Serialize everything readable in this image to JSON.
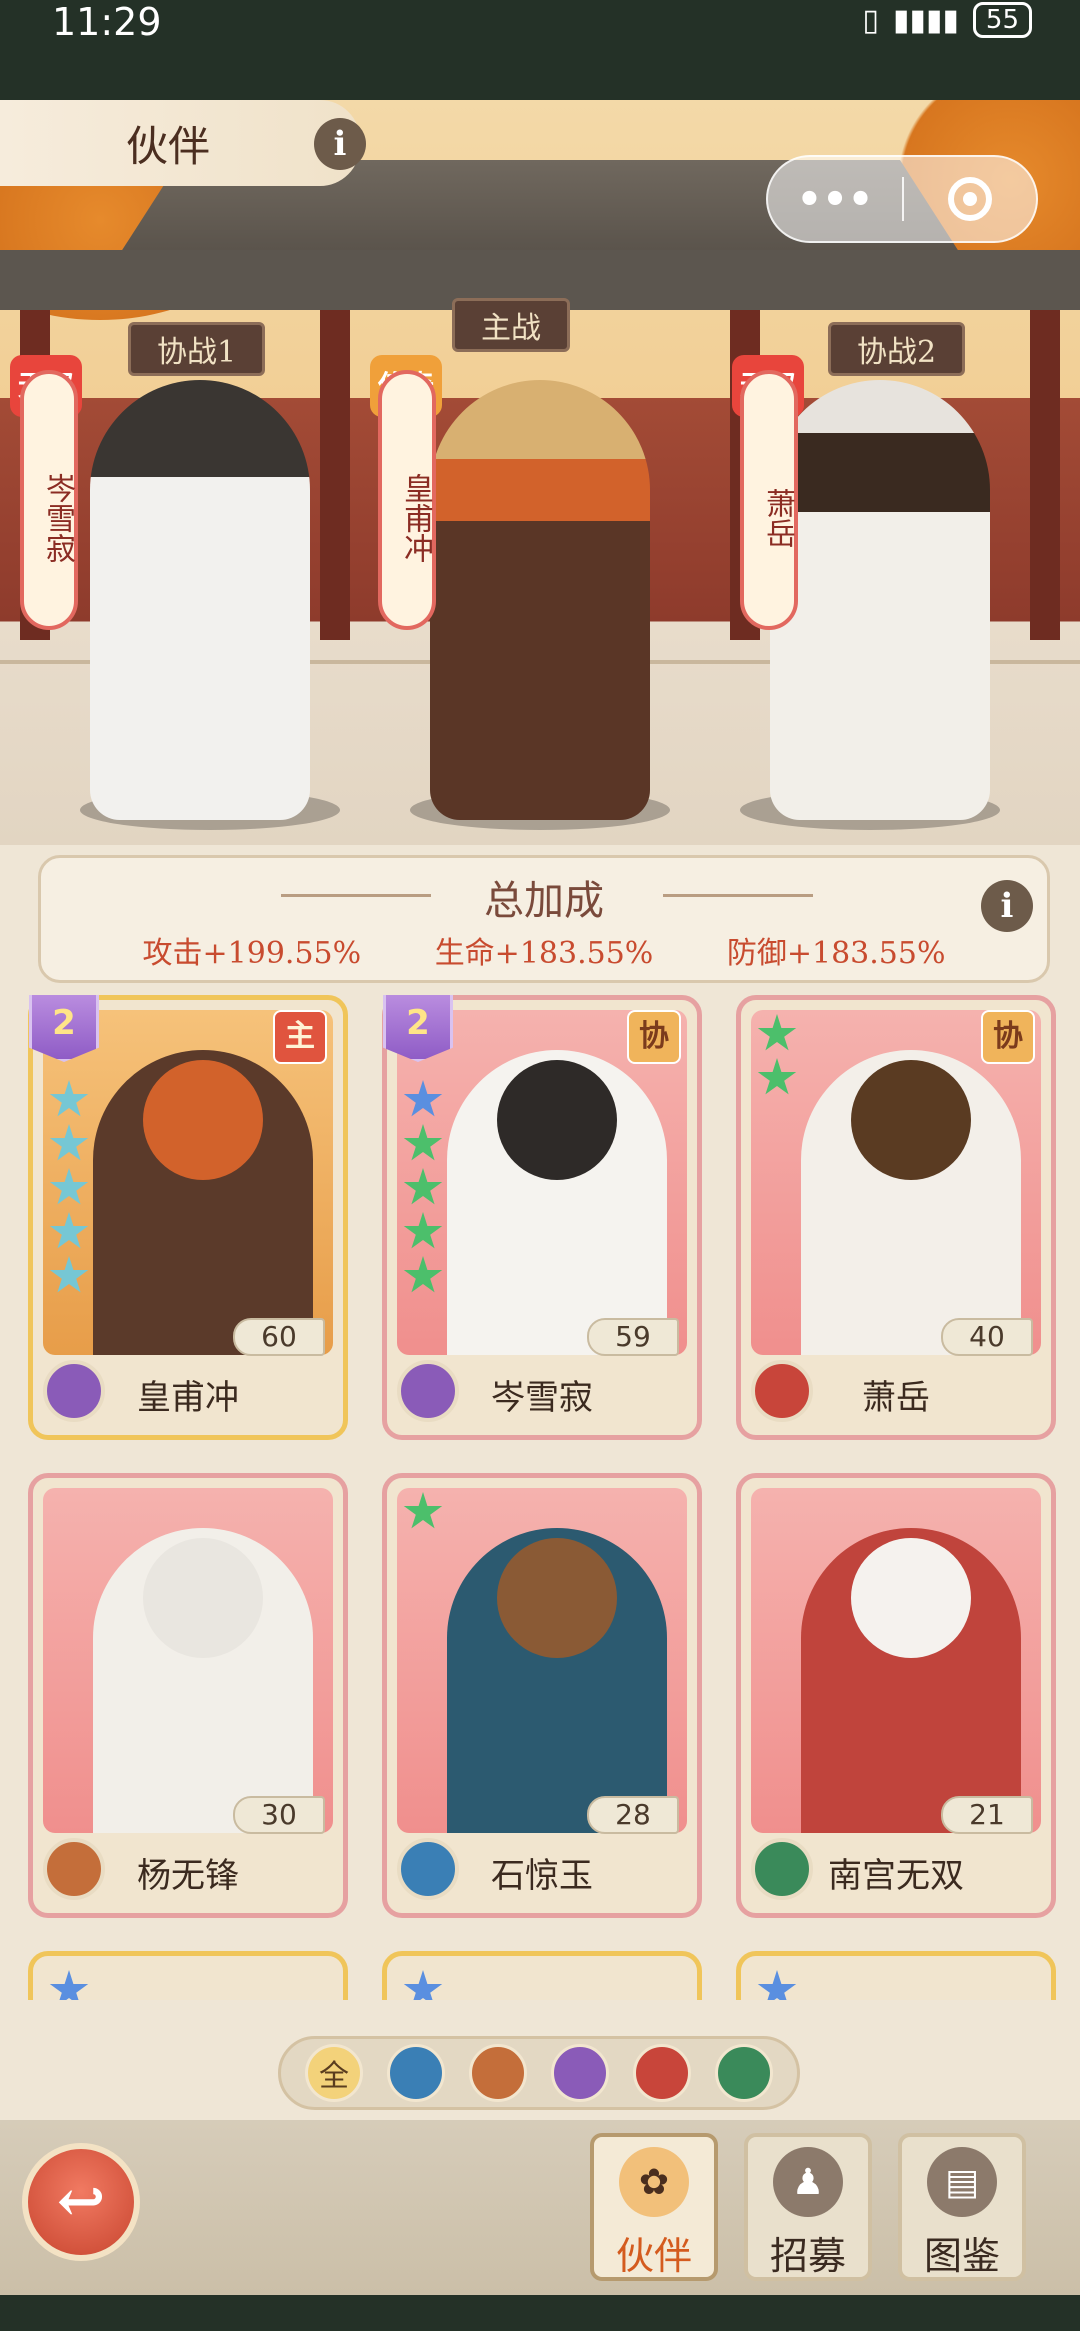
{
  "status_bar": {
    "time": "11:29",
    "signal": "▮▮▮▮",
    "battery": "55"
  },
  "header": {
    "title": "伙伴",
    "info_glyph": "i",
    "capsule": {
      "more": "•••"
    }
  },
  "lineup": {
    "slots": [
      {
        "plaque": "协战1",
        "rarity": "无双",
        "name": "岑雪寂",
        "rarity_color": "#e8453c"
      },
      {
        "plaque": "主战",
        "rarity": "传奇",
        "name": "皇甫冲",
        "rarity_color": "#f0a03a"
      },
      {
        "plaque": "协战2",
        "rarity": "无双",
        "name": "萧岳",
        "rarity_color": "#e8453c"
      }
    ]
  },
  "bonus": {
    "title": "总加成",
    "info_glyph": "i",
    "attack": "攻击+199.55%",
    "hp": "生命+183.55%",
    "defense": "防御+183.55%"
  },
  "cards": [
    {
      "name": "皇甫冲",
      "level": "60",
      "role": "主",
      "plus": "2",
      "stars": [
        "c",
        "c",
        "c",
        "c",
        "c"
      ],
      "faction_color": "#8a5bb8",
      "border": "gold"
    },
    {
      "name": "岑雪寂",
      "level": "59",
      "role": "协",
      "plus": "2",
      "stars": [
        "b",
        "g",
        "g",
        "g",
        "g"
      ],
      "faction_color": "#8a5bb8",
      "border": "pink"
    },
    {
      "name": "萧岳",
      "level": "40",
      "role": "协",
      "plus": "",
      "stars": [
        "g",
        "g"
      ],
      "faction_color": "#c8453a",
      "border": "pink"
    },
    {
      "name": "杨无锋",
      "level": "30",
      "role": "",
      "plus": "",
      "stars": [],
      "faction_color": "#c46e3a",
      "border": "pink"
    },
    {
      "name": "石惊玉",
      "level": "28",
      "role": "",
      "plus": "",
      "stars": [
        "g"
      ],
      "faction_color": "#3a7fb5",
      "border": "pink"
    },
    {
      "name": "南宫无双",
      "level": "21",
      "role": "",
      "plus": "",
      "stars": [],
      "faction_color": "#3a8a5a",
      "border": "pink"
    }
  ],
  "filters": [
    {
      "label": "全",
      "color": "#f3d27a"
    },
    {
      "label": "",
      "color": "#3a7fb5"
    },
    {
      "label": "",
      "color": "#c46e3a"
    },
    {
      "label": "",
      "color": "#8a5bb8"
    },
    {
      "label": "",
      "color": "#c8453a"
    },
    {
      "label": "",
      "color": "#3a8a5a"
    }
  ],
  "nav": {
    "back_glyph": "↩",
    "tabs": [
      {
        "label": "伙伴",
        "active": true
      },
      {
        "label": "招募",
        "active": false
      },
      {
        "label": "图鉴",
        "active": false
      }
    ]
  }
}
